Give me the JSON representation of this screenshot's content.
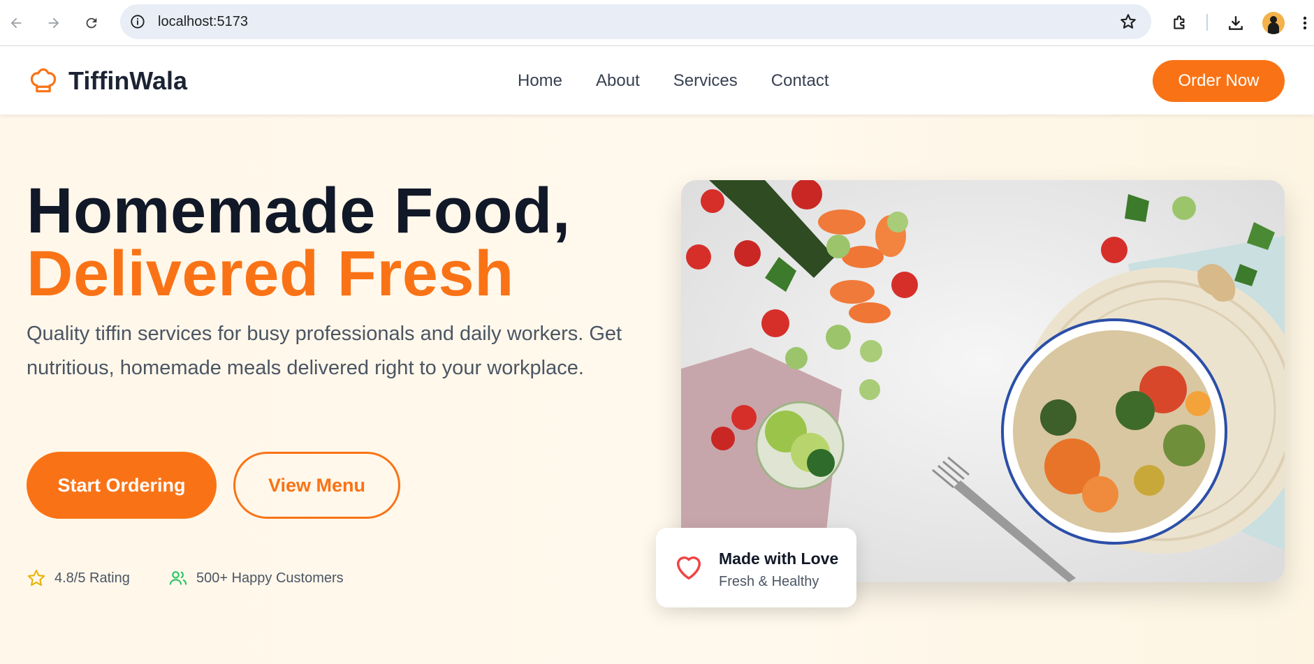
{
  "browser": {
    "url": "localhost:5173"
  },
  "header": {
    "brand": "TiffinWala",
    "nav": [
      "Home",
      "About",
      "Services",
      "Contact"
    ],
    "cta": "Order Now"
  },
  "hero": {
    "title_line1": "Homemade Food,",
    "title_line2": "Delivered Fresh",
    "description": "Quality tiffin services for busy professionals and daily workers. Get nutritious, homemade meals delivered right to your workplace.",
    "primary_button": "Start Ordering",
    "secondary_button": "View Menu",
    "stats": {
      "rating": "4.8/5 Rating",
      "customers": "500+ Happy Customers"
    },
    "badge": {
      "title": "Made with Love",
      "subtitle": "Fresh & Healthy"
    }
  },
  "colors": {
    "accent": "#f97316",
    "heading": "#111827",
    "hero_bg": "#fff7ea",
    "star": "#eab308",
    "users": "#22c55e",
    "heart": "#ef4444"
  }
}
